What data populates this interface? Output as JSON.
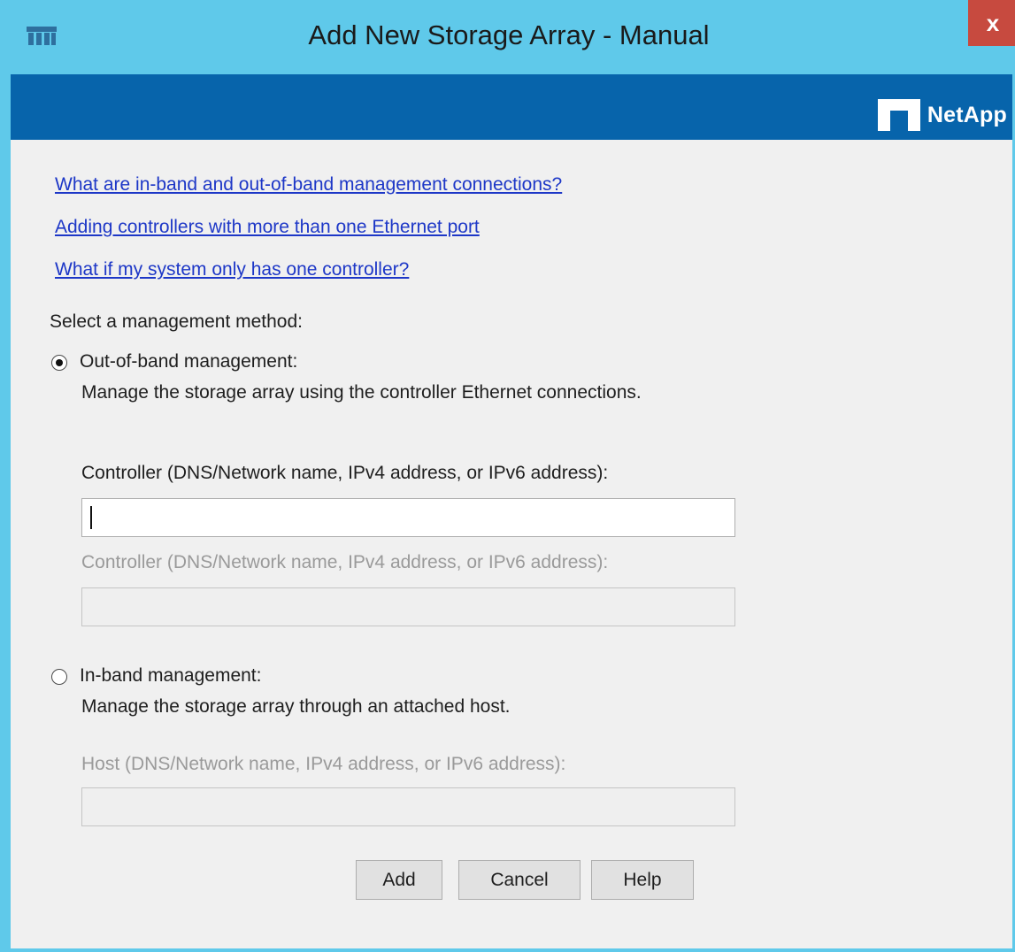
{
  "window": {
    "title": "Add New Storage Array - Manual",
    "close_label": "x"
  },
  "brand": {
    "logo_text": "NetApp",
    "logo_icon": "netapp-logo-icon",
    "banner_color": "#0764ab",
    "titlebar_color": "#5fc9ea"
  },
  "help_links": [
    "What are in-band and out-of-band management connections?",
    "Adding controllers with more than one Ethernet port",
    "What if my system only has one controller?"
  ],
  "method_prompt": "Select a management method:",
  "out_of_band": {
    "label": "Out-of-band management:",
    "description": "Manage the storage array using the controller Ethernet connections.",
    "selected": true,
    "controller1_label": "Controller (DNS/Network name, IPv4 address, or IPv6 address):",
    "controller1_value": "",
    "controller2_label": "Controller (DNS/Network name, IPv4 address, or IPv6 address):",
    "controller2_value": ""
  },
  "in_band": {
    "label": "In-band management:",
    "description": "Manage the storage array through an attached host.",
    "selected": false,
    "host_label": "Host (DNS/Network name, IPv4 address, or IPv6 address):",
    "host_value": ""
  },
  "buttons": {
    "add": "Add",
    "cancel": "Cancel",
    "help": "Help"
  },
  "colors": {
    "link": "#1d37c7",
    "close": "#c74a3f"
  }
}
